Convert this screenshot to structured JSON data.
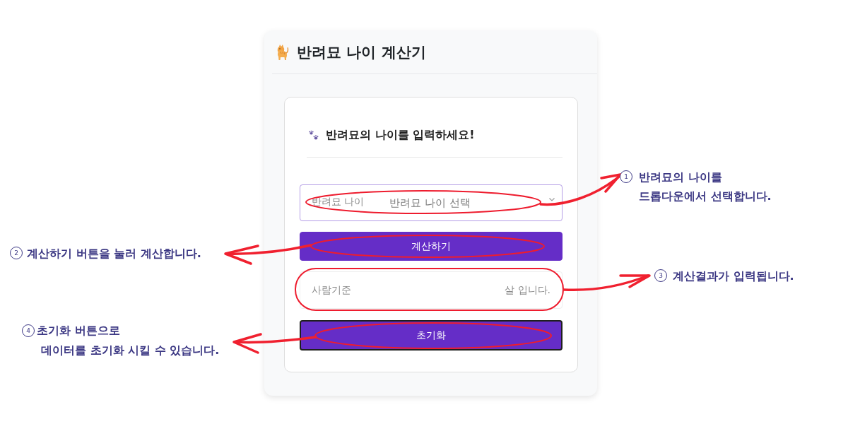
{
  "header": {
    "title": "반려묘 나이 계산기"
  },
  "form": {
    "heading": "반려묘의 나이를 입력하세요!",
    "age_select": {
      "label": "반려묘 나이",
      "placeholder": "반려묘 나이 선택"
    },
    "calculate_button": {
      "label": "계산하기",
      "focused": false
    },
    "result": {
      "prefix": "사람기준",
      "suffix": "살 입니다."
    },
    "reset_button": {
      "label": "초기화",
      "focused": true
    }
  },
  "annotations": [
    {
      "number": "1",
      "lines": [
        "반려묘의 나이를",
        "드롭다운에서 선택합니다."
      ]
    },
    {
      "number": "2",
      "lines": [
        "계산하기 버튼을 눌러 계산합니다."
      ]
    },
    {
      "number": "3",
      "lines": [
        "계산결과가 입력됩니다."
      ]
    },
    {
      "number": "4",
      "lines": [
        "초기화 버튼으로",
        "데이터를 초기화 시킬 수 있습니다."
      ]
    }
  ]
}
